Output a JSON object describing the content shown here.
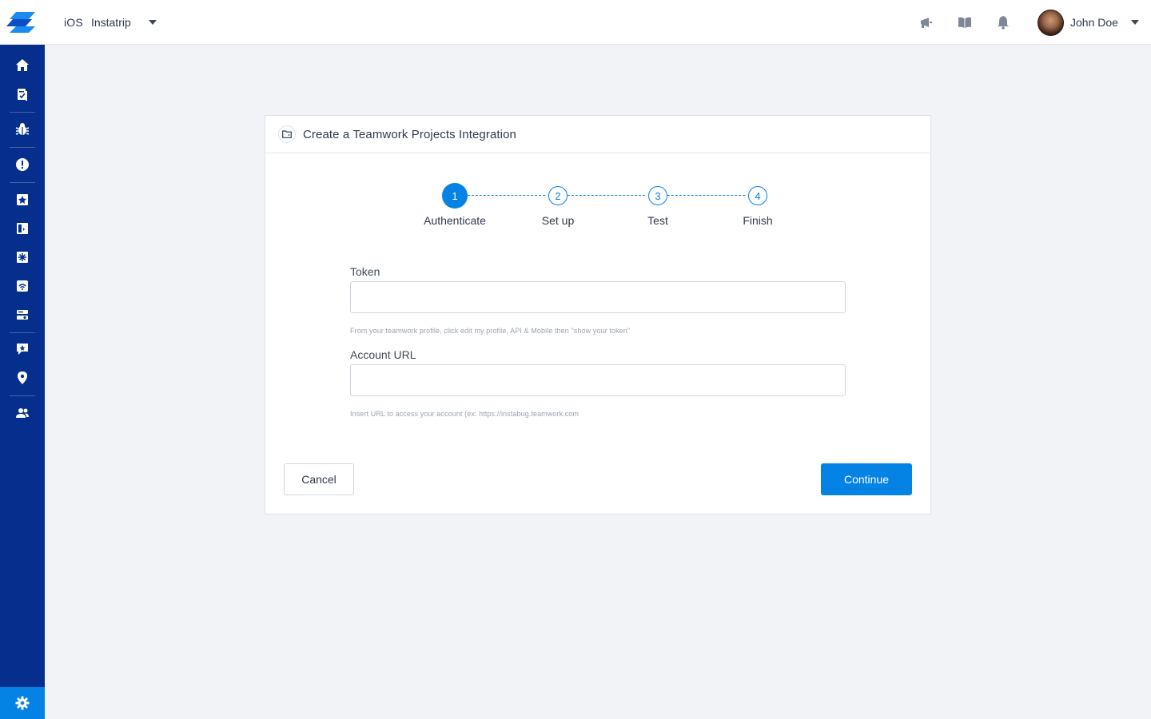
{
  "topbar": {
    "platform": "iOS",
    "app_name": "Instatrip",
    "icons": [
      "announcement-icon",
      "docs-book-icon",
      "notification-bell-icon"
    ],
    "user_name": "John Doe"
  },
  "sidebar": {
    "items": [
      {
        "icon": "home-icon"
      },
      {
        "icon": "reports-icon"
      },
      {
        "icon": "bug-icon"
      },
      {
        "icon": "crash-alert-icon"
      },
      {
        "icon": "app-ratings-icon"
      },
      {
        "icon": "surveys-icon"
      },
      {
        "icon": "features-icon"
      },
      {
        "icon": "network-icon"
      },
      {
        "icon": "integrations-icon"
      },
      {
        "icon": "chats-icon"
      },
      {
        "icon": "location-pin-icon"
      },
      {
        "icon": "team-users-icon"
      }
    ],
    "settings_icon": "gear-icon"
  },
  "dialog": {
    "header_icon": "integration-folder-icon",
    "title": "Create a Teamwork Projects Integration",
    "steps": [
      {
        "number": "1",
        "label": "Authenticate",
        "active": true
      },
      {
        "number": "2",
        "label": "Set up",
        "active": false
      },
      {
        "number": "3",
        "label": "Test",
        "active": false
      },
      {
        "number": "4",
        "label": "Finish",
        "active": false
      }
    ],
    "token": {
      "label": "Token",
      "value": "",
      "hint": "From your teamwork profile, click edit my profile, API & Mobile then \"show your token\""
    },
    "account_url": {
      "label": "Account URL",
      "value": "",
      "hint": "Insert URL to access your account (ex: https://instabug.teamwork.com"
    },
    "cancel_label": "Cancel",
    "continue_label": "Continue"
  },
  "colors": {
    "sidebar_bg": "#062e8c",
    "accent": "#0583e4",
    "page_bg": "#f2f3f7"
  }
}
